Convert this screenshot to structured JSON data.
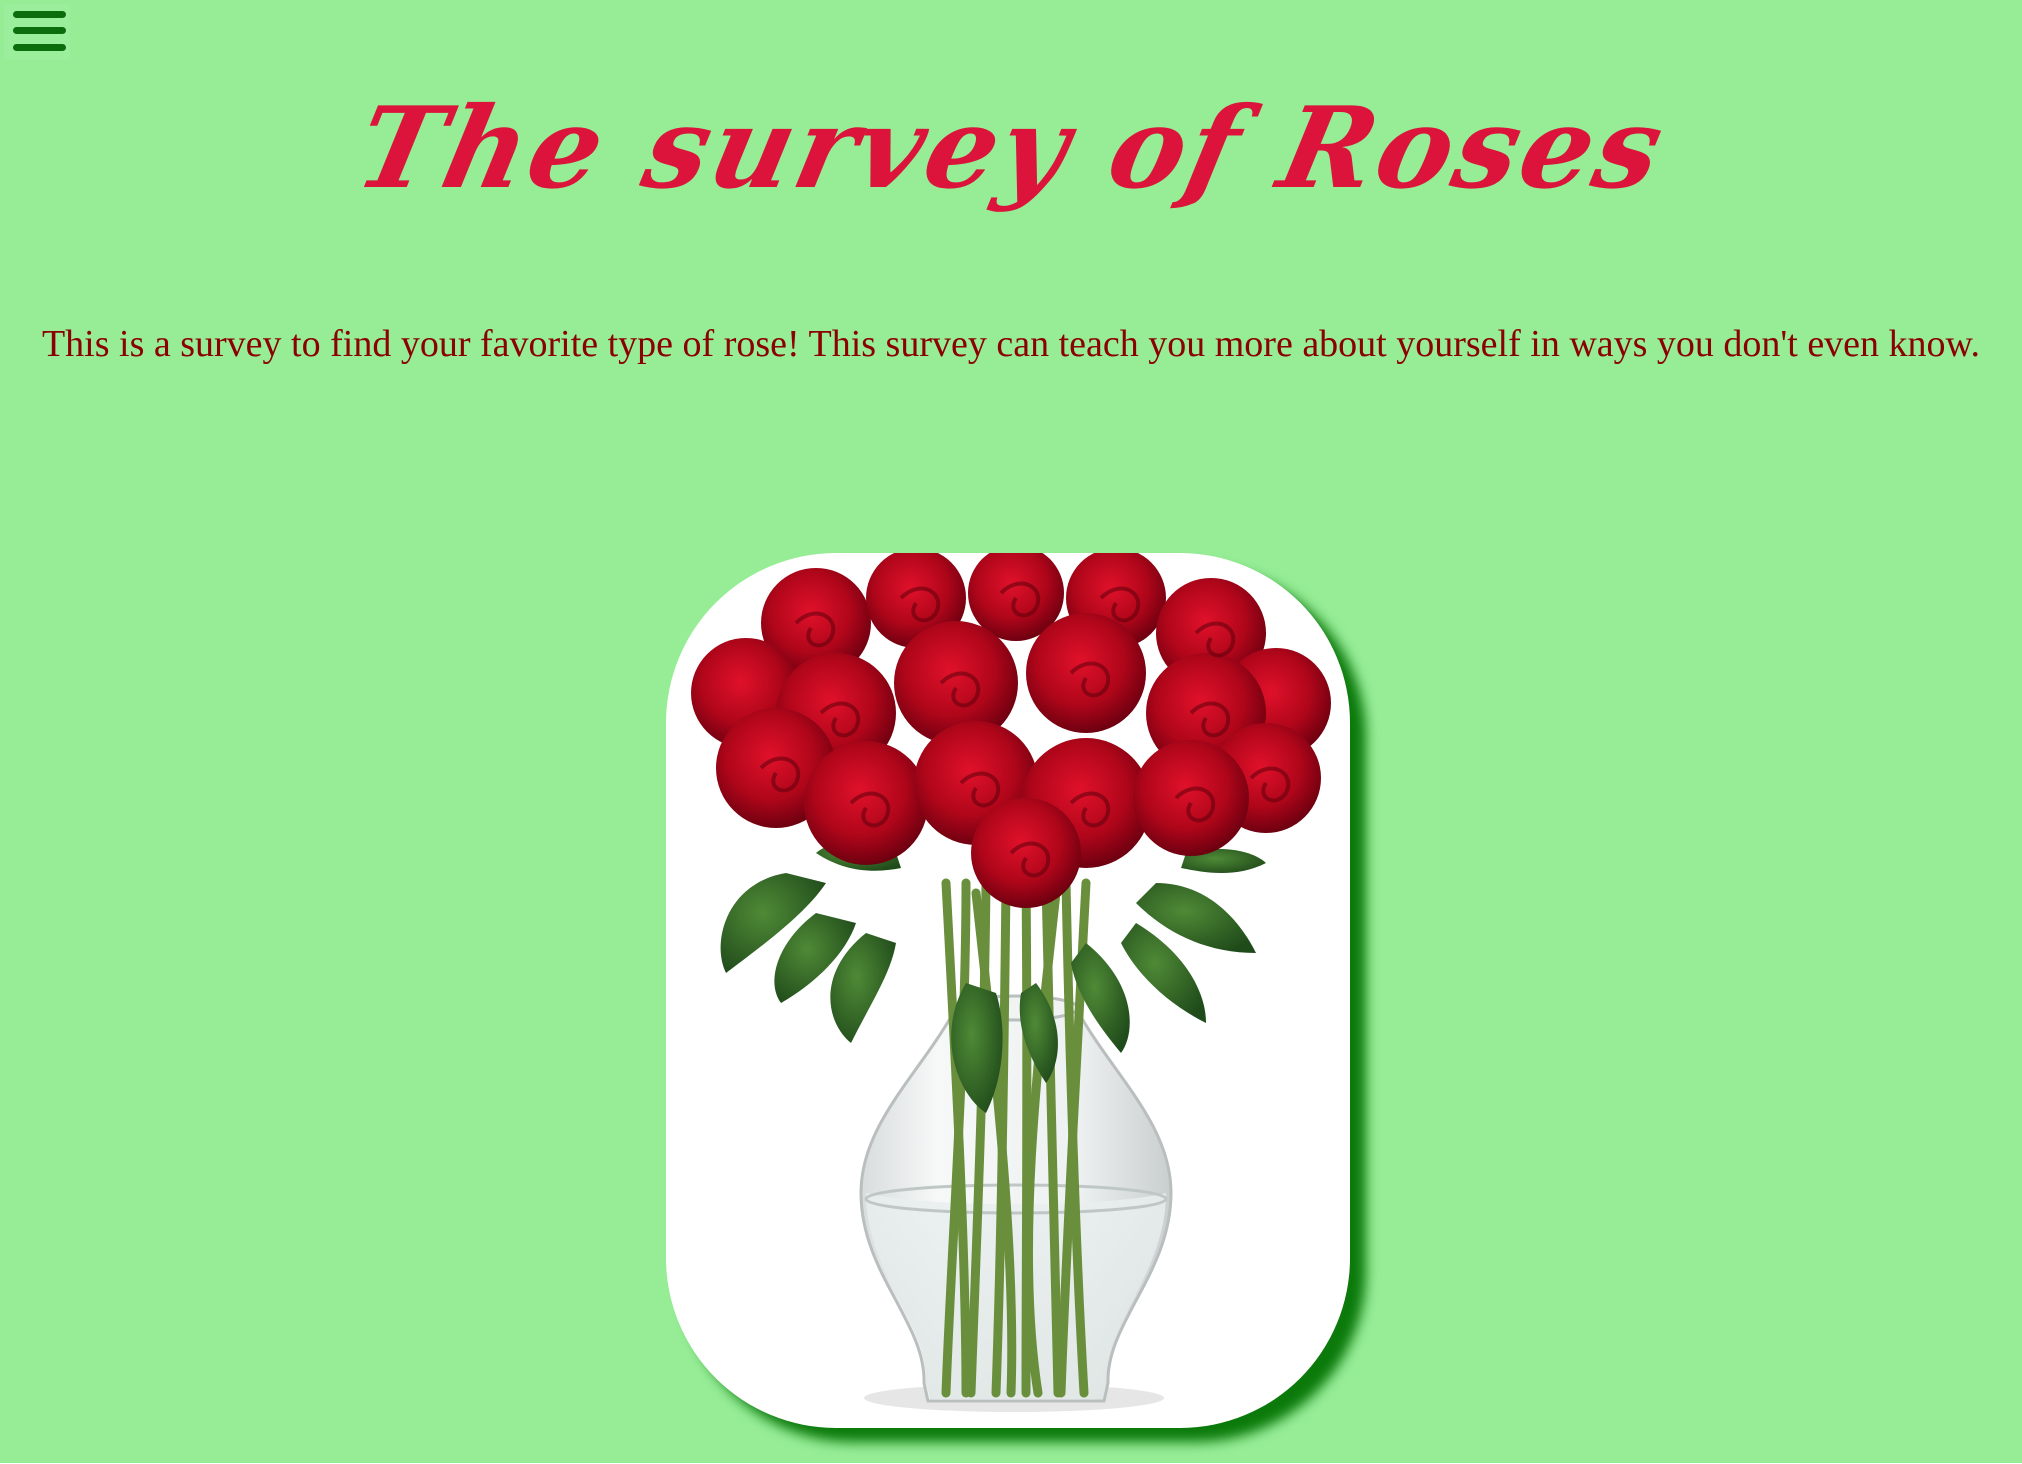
{
  "nav": {
    "menu_icon": "hamburger-menu-icon"
  },
  "header": {
    "title": "The survey of Roses"
  },
  "intro": {
    "text": "This is a survey to find your favorite type of rose! This survey can teach you more about yourself in ways you don't even know."
  },
  "hero_image": {
    "subject": "bouquet of red roses in glass vase"
  },
  "colors": {
    "background": "#96ed96",
    "title": "#dc143c",
    "intro_text": "#8b0000",
    "menu_icon": "#0b6d0b",
    "image_shadow": "#0b7a0b"
  }
}
